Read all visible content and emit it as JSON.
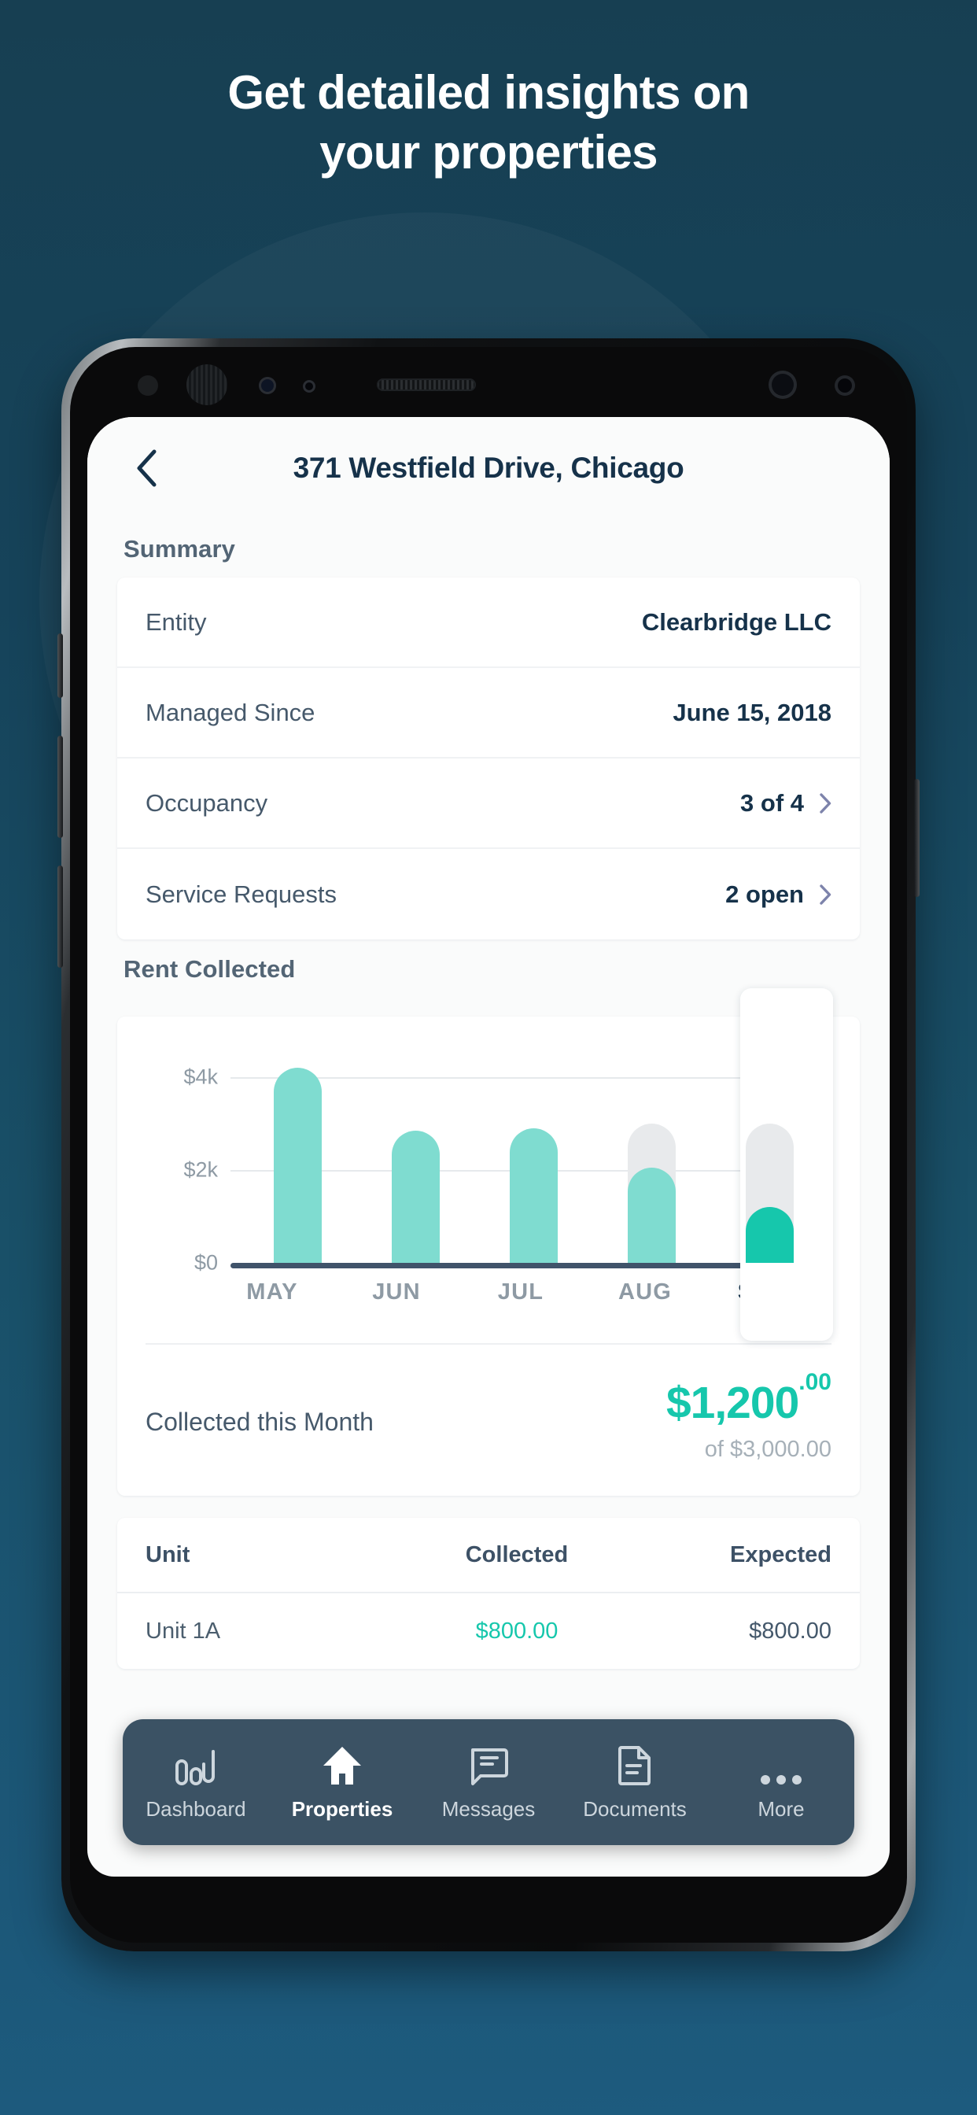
{
  "promo": {
    "headline_line1": "Get detailed insights on",
    "headline_line2": "your properties"
  },
  "colors": {
    "background_top": "#173f52",
    "background_bottom": "#1d5b7e",
    "accent_teal": "#16c7ac",
    "bar_teal": "#7fdcd0",
    "bar_ghost": "#e8eaec",
    "title_navy": "#16324a",
    "nav_bar": "#3b5264"
  },
  "app": {
    "header": {
      "back_icon": "chevron-left-icon",
      "title": "371 Westfield Drive, Chicago"
    },
    "summary": {
      "label": "Summary",
      "rows": [
        {
          "key": "Entity",
          "value": "Clearbridge LLC",
          "chevron": false
        },
        {
          "key": "Managed Since",
          "value": "June 15, 2018",
          "chevron": false
        },
        {
          "key": "Occupancy",
          "value": "3 of 4",
          "chevron": true
        },
        {
          "key": "Service Requests",
          "value": "2 open",
          "chevron": true
        }
      ]
    },
    "rent": {
      "label": "Rent Collected",
      "collected_label": "Collected this Month",
      "collected_amount": "$1,200",
      "collected_cents": ".00",
      "collected_of": "of $3,000.00"
    },
    "units_table": {
      "columns": [
        "Unit",
        "Collected",
        "Expected"
      ],
      "rows": [
        {
          "unit": "Unit 1A",
          "collected": "$800.00",
          "expected": "$800.00"
        }
      ]
    },
    "bottom_nav": [
      {
        "label": "Dashboard",
        "icon": "bar-chart-icon",
        "active": false
      },
      {
        "label": "Properties",
        "icon": "home-icon",
        "active": true
      },
      {
        "label": "Messages",
        "icon": "chat-bubble-icon",
        "active": false
      },
      {
        "label": "Documents",
        "icon": "document-icon",
        "active": false
      },
      {
        "label": "More",
        "icon": "ellipsis-icon",
        "active": false
      }
    ]
  },
  "chart_data": {
    "type": "bar",
    "title": "Rent Collected",
    "xlabel": "",
    "ylabel": "",
    "categories": [
      "MAY",
      "JUN",
      "JUL",
      "AUG",
      "SEPT"
    ],
    "values": [
      4200,
      2850,
      2900,
      2050,
      1200
    ],
    "expected": [
      4200,
      2850,
      2900,
      3000,
      3000
    ],
    "highlight_category": "SEPT",
    "ylim": [
      0,
      4800
    ],
    "yticks": [
      0,
      2000,
      4000
    ],
    "ytick_labels": [
      "$0",
      "$2k",
      "$4k"
    ],
    "grid": true,
    "legend": "none"
  }
}
